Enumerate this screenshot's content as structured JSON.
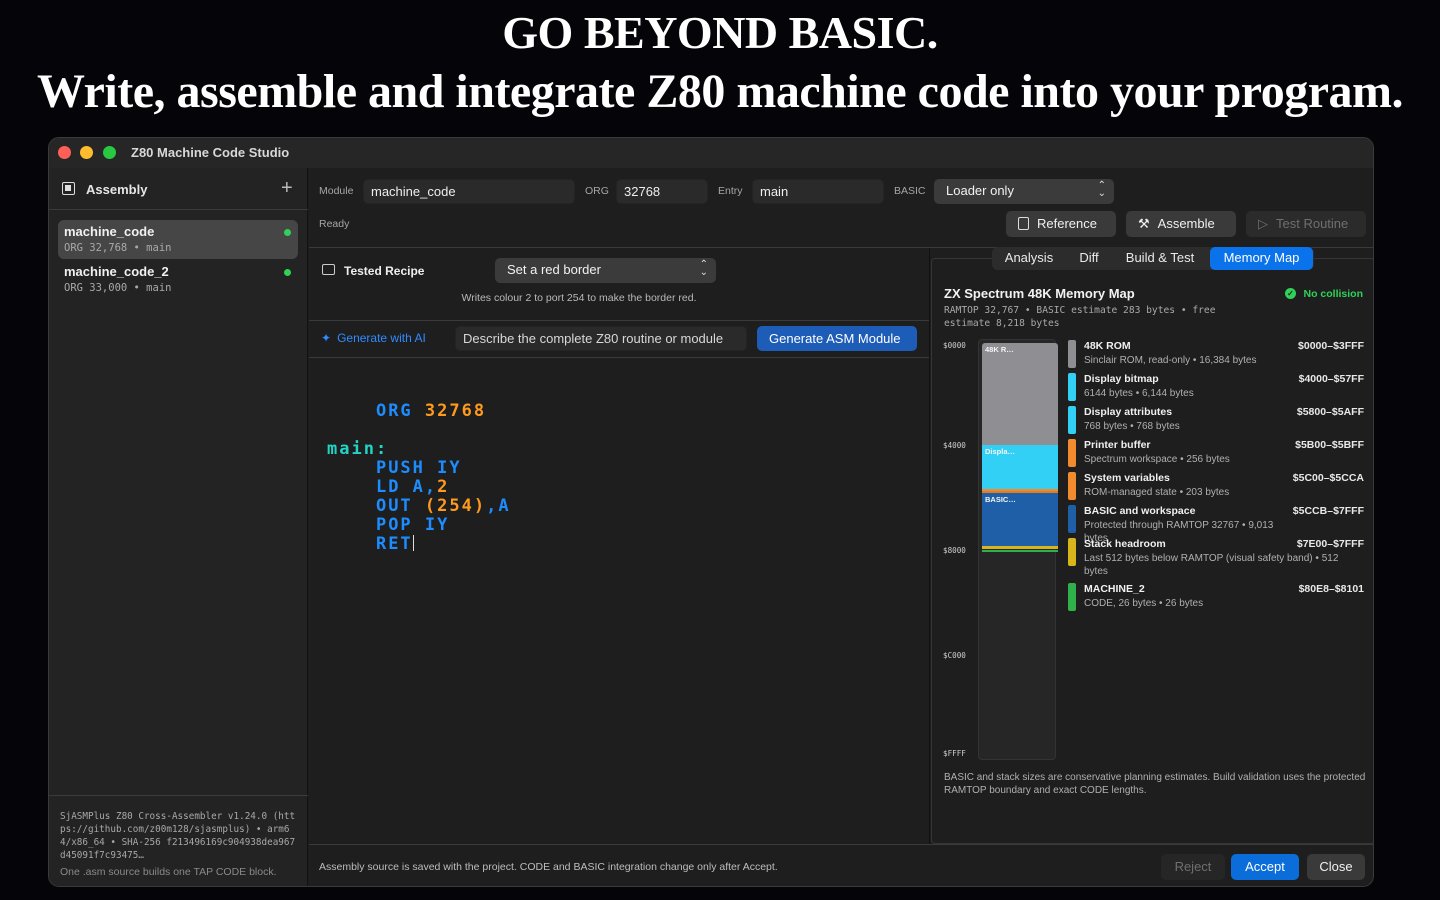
{
  "headline": {
    "line1": "GO BEYOND BASIC.",
    "line2": "Write, assemble and integrate Z80 machine code into your program."
  },
  "window": {
    "title": "Z80 Machine Code Studio"
  },
  "sidebar": {
    "title": "Assembly",
    "add_label": "+",
    "modules": [
      {
        "name": "machine_code",
        "sub": "ORG 32,768 • main",
        "status": "ok"
      },
      {
        "name": "machine_code_2",
        "sub": "ORG 33,000 • main",
        "status": "ok"
      }
    ],
    "footer_info": "SjASMPlus Z80 Cross-Assembler v1.24.0 (https://github.com/z00m128/sjasmplus) • arm64/x86_64 • SHA-256 f213496169c904938dea967d45091f7c93475…",
    "footer_note": "One .asm source builds one TAP CODE block."
  },
  "toolbar": {
    "module_label": "Module",
    "module_value": "machine_code",
    "org_label": "ORG",
    "org_value": "32768",
    "entry_label": "Entry",
    "entry_value": "main",
    "basic_label": "BASIC",
    "basic_value": "Loader only",
    "status": "Ready",
    "reference_label": "Reference",
    "assemble_label": "Assemble",
    "test_label": "Test Routine"
  },
  "recipe": {
    "label": "Tested Recipe",
    "selected": "Set a red border",
    "description": "Writes colour 2 to port 254 to make the border red."
  },
  "ai": {
    "label": "Generate with AI",
    "placeholder": "Describe the complete Z80 routine or module",
    "button": "Generate ASM Module"
  },
  "code": {
    "org_kw": "ORG",
    "org_num": "32768",
    "label": "main:",
    "push": "PUSH IY",
    "ld_op": "LD A,",
    "ld_num": "2",
    "out_op": "OUT ",
    "out_num": "(254)",
    "out_rest": ",A",
    "pop": "POP IY",
    "ret": "RET"
  },
  "tabs": [
    {
      "label": "Analysis"
    },
    {
      "label": "Diff"
    },
    {
      "label": "Build & Test"
    },
    {
      "label": "Memory Map",
      "active": true
    }
  ],
  "memory_map": {
    "title": "ZX Spectrum 48K Memory Map",
    "subtitle": "RAMTOP 32,767 • BASIC estimate 283 bytes • free estimate 8,218 bytes",
    "status": "No collision",
    "axis": [
      "$0000",
      "$4000",
      "$8000",
      "$C000",
      "$FFFF"
    ],
    "bar_labels": {
      "rom": "48K R…",
      "display": "Displa…",
      "basic": "BASIC…"
    },
    "regions": [
      {
        "name": "48K ROM",
        "desc": "Sinclair ROM, read-only • 16,384 bytes",
        "range": "$0000–$3FFF",
        "color": "#8e8e93"
      },
      {
        "name": "Display bitmap",
        "desc": "6144 bytes • 6,144 bytes",
        "range": "$4000–$57FF",
        "color": "#32d0f5"
      },
      {
        "name": "Display attributes",
        "desc": "768 bytes • 768 bytes",
        "range": "$5800–$5AFF",
        "color": "#32d0f5"
      },
      {
        "name": "Printer buffer",
        "desc": "Spectrum workspace • 256 bytes",
        "range": "$5B00–$5BFF",
        "color": "#f28a2e"
      },
      {
        "name": "System variables",
        "desc": "ROM-managed state • 203 bytes",
        "range": "$5C00–$5CCA",
        "color": "#f28a2e"
      },
      {
        "name": "BASIC and workspace",
        "desc": "Protected through RAMTOP 32767 • 9,013 bytes",
        "range": "$5CCB–$7FFF",
        "color": "#1f5fa8"
      },
      {
        "name": "Stack headroom",
        "desc": "Last 512 bytes below RAMTOP (visual safety band) • 512 bytes",
        "range": "$7E00–$7FFF",
        "color": "#d8b51a"
      },
      {
        "name": "MACHINE_2",
        "desc": "CODE, 26 bytes • 26 bytes",
        "range": "$80E8–$8101",
        "color": "#30b04a"
      }
    ],
    "note": "BASIC and stack sizes are conservative planning estimates. Build validation uses the protected RAMTOP boundary and exact CODE lengths."
  },
  "footer": {
    "note": "Assembly source is saved with the project. CODE and BASIC integration change only after Accept.",
    "reject": "Reject",
    "accept": "Accept",
    "close": "Close"
  }
}
